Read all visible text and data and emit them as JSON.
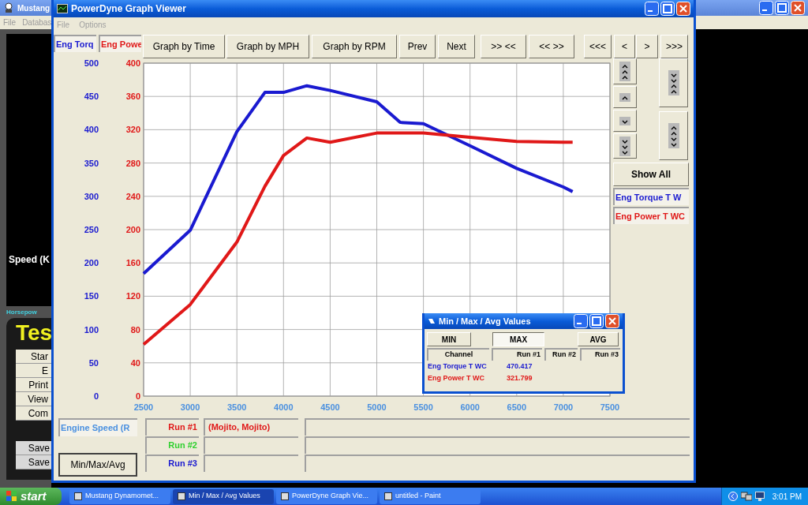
{
  "background_window": {
    "title": "Mustang",
    "menu": [
      "File",
      "Databas"
    ],
    "speed_label": "Speed (K",
    "horsepower_label": "Horsepow",
    "test_title": "Tes",
    "buttons": [
      "Star",
      "E",
      "Print",
      "View",
      "Com"
    ],
    "save_buttons": [
      "Save",
      "Save"
    ]
  },
  "window": {
    "title": "PowerDyne Graph Viewer",
    "menu": [
      {
        "label": "File",
        "disabled": true
      },
      {
        "label": "Options",
        "disabled": true
      }
    ]
  },
  "axis_headers": [
    {
      "label": "Eng Torq",
      "color": "#1a1ad0"
    },
    {
      "label": "Eng Powe",
      "color": "#e01818"
    }
  ],
  "toolbar": [
    "Graph by Time",
    "Graph by MPH",
    "Graph by RPM",
    "Prev",
    "Next",
    ">> <<",
    "<< >>",
    "<<<",
    "<",
    ">",
    ">>>"
  ],
  "chart": {
    "chart_data": {
      "type": "line",
      "grid": true,
      "x": [
        2500,
        3000,
        3500,
        3800,
        4000,
        4250,
        4500,
        5000,
        5250,
        5500,
        6000,
        6500,
        7000,
        7100
      ],
      "xlim": [
        2500,
        7500
      ],
      "xticks": [
        2500,
        3000,
        3500,
        4000,
        4500,
        5000,
        5500,
        6000,
        6500,
        7000,
        7500
      ],
      "ylim": [
        0,
        500
      ],
      "yticks": [
        0,
        50,
        100,
        150,
        200,
        250,
        300,
        350,
        400,
        450,
        500
      ],
      "y2lim": [
        0,
        400
      ],
      "y2ticks": [
        0,
        40,
        80,
        120,
        160,
        200,
        240,
        280,
        320,
        360,
        400
      ],
      "series": [
        {
          "name": "Eng Torque T W",
          "color": "#1a1ad0",
          "values": [
            184,
            249,
            397,
            456,
            456,
            466,
            459,
            442,
            411,
            409,
            376,
            342,
            314,
            307
          ]
        },
        {
          "name": "Eng Power T WC",
          "color": "#e01818",
          "axis": "y2",
          "values": [
            62,
            110,
            185,
            252,
            289,
            310,
            305,
            316,
            316,
            316,
            311,
            306,
            305,
            305
          ]
        }
      ]
    }
  },
  "show_all": "Show All",
  "x_channel": "Engine Speed (R",
  "minmaxavg_button": "Min/Max/Avg",
  "runs": [
    {
      "label": "Run #1",
      "color": "#e01818",
      "name": "(Mojito, Mojito)"
    },
    {
      "label": "Run #2",
      "color": "#30d030"
    },
    {
      "label": "Run #3",
      "color": "#1a1ad0"
    }
  ],
  "dialog": {
    "title": "Min / Max / Avg Values",
    "modes": [
      {
        "label": "MIN",
        "selected": false
      },
      {
        "label": "MAX",
        "selected": true
      },
      {
        "label": "AVG",
        "selected": false
      }
    ],
    "columns": [
      "Channel",
      "Run #1",
      "Run #2",
      "Run #3"
    ],
    "rows": [
      {
        "channel": "Eng Torque T WC",
        "run1": "470.417",
        "color": "#1a1ad0"
      },
      {
        "channel": "Eng Power T WC",
        "run1": "321.799",
        "color": "#e01818"
      }
    ]
  },
  "taskbar": {
    "start": "start",
    "items": [
      {
        "label": "Mustang Dynamomet...",
        "selected": false
      },
      {
        "label": "Min / Max / Avg Values",
        "selected": true
      },
      {
        "label": "PowerDyne Graph Vie...",
        "selected": false
      },
      {
        "label": "untitled - Paint",
        "selected": false
      }
    ],
    "time": "3:01 PM"
  }
}
